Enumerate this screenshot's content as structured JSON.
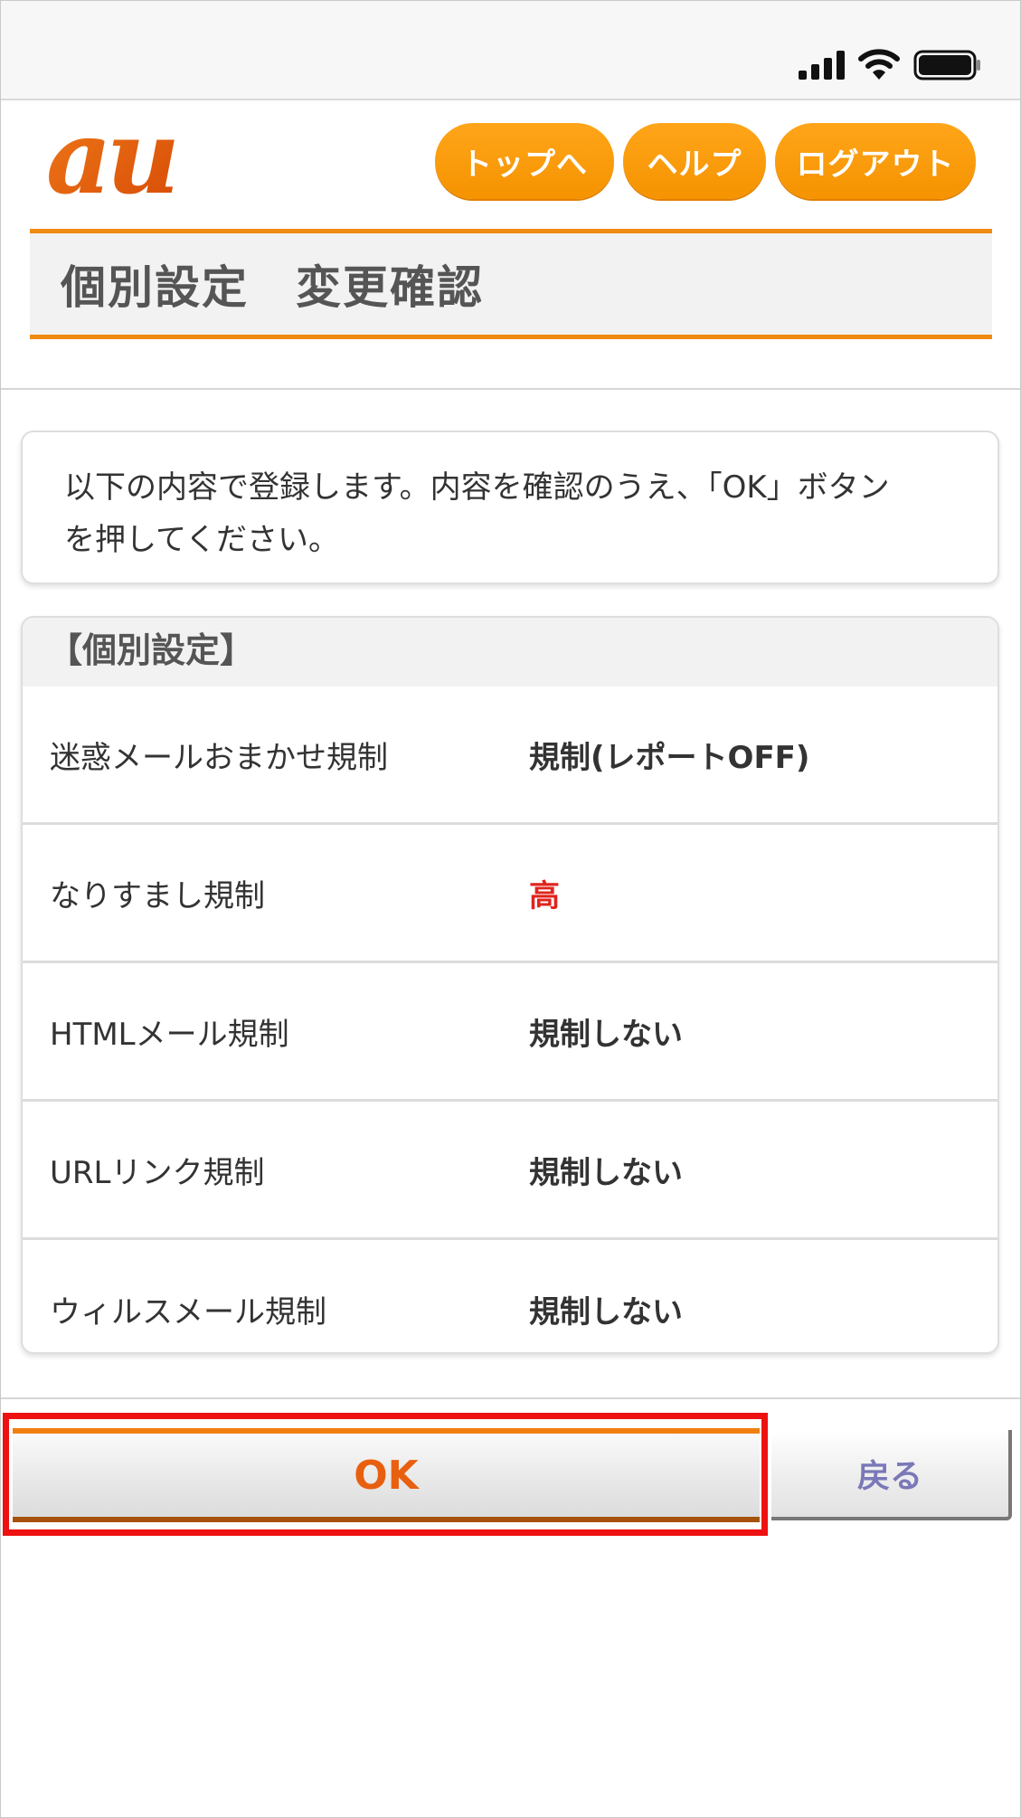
{
  "status_bar": {
    "icons": [
      "signal-icon",
      "wifi-icon",
      "battery-icon"
    ]
  },
  "header": {
    "logo_text": "au",
    "nav": {
      "top": "トップへ",
      "help": "ヘルプ",
      "logout": "ログアウト"
    },
    "title": "個別設定　変更確認"
  },
  "notice": {
    "line1": "以下の内容で登録します。内容を確認のうえ、「OK」ボタン",
    "line2": "を押してください。"
  },
  "settings": {
    "heading": "【個別設定】",
    "rows": [
      {
        "label": "迷惑メールおまかせ規制",
        "value": "規制(レポートOFF)"
      },
      {
        "label": "なりすまし規制",
        "value": "高"
      },
      {
        "label": "HTMLメール規制",
        "value": "規制しない"
      },
      {
        "label": "URLリンク規制",
        "value": "規制しない"
      },
      {
        "label": "ウィルスメール規制",
        "value": "規制しない"
      }
    ]
  },
  "actions": {
    "ok": "OK",
    "back": "戻る"
  },
  "colors": {
    "accent_orange": "#f08a10",
    "nav_button": "#f7a000",
    "highlight_red": "#ee1111",
    "value_red": "#e0241d"
  }
}
